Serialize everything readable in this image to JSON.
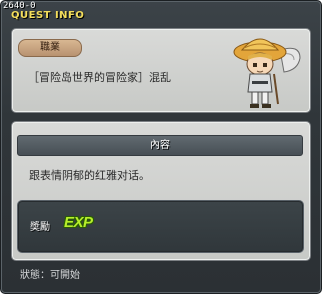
{
  "window": {
    "quest_id": "2640-0",
    "title": "QUEST INFO"
  },
  "job_section": {
    "label": "職業",
    "quest_name": "［冒险岛世界的冒险家］混乱"
  },
  "content_section": {
    "header": "內容",
    "description": "跟表情阴郁的红雅对话。"
  },
  "reward": {
    "label": "奬勵",
    "items": [
      {
        "icon": "exp-icon",
        "text": "EXP"
      }
    ]
  },
  "status": {
    "text": "狀態：可開始"
  },
  "character": {
    "icon": "npc-character-portrait"
  },
  "colors": {
    "title": "#f4de5c",
    "exp": "#b7ef2b",
    "window_bg": "#30363a",
    "panel_bg": "#d3d5d2"
  }
}
